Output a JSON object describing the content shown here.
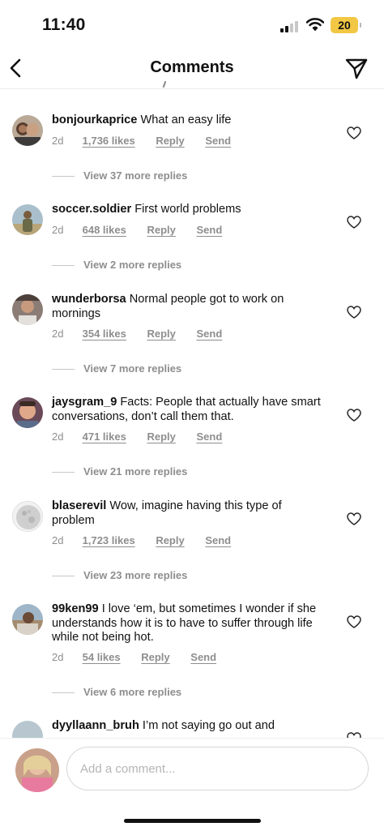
{
  "status": {
    "time": "11:40",
    "battery": "20"
  },
  "header": {
    "title": "Comments"
  },
  "comments": [
    {
      "username": "bonjourkaprice",
      "text": "What an easy life",
      "time": "2d",
      "likes": "1,736 likes",
      "reply": "Reply",
      "send": "Send",
      "replies": "View 37 more replies"
    },
    {
      "username": "soccer.soldier",
      "text": "First world problems",
      "time": "2d",
      "likes": "648 likes",
      "reply": "Reply",
      "send": "Send",
      "replies": "View 2 more replies"
    },
    {
      "username": "wunderborsa",
      "text": "Normal people got to work on mornings",
      "time": "2d",
      "likes": "354 likes",
      "reply": "Reply",
      "send": "Send",
      "replies": "View 7 more replies"
    },
    {
      "username": "jaysgram_9",
      "text": "Facts: People that actually have smart conversations, don’t call them that.",
      "time": "2d",
      "likes": "471 likes",
      "reply": "Reply",
      "send": "Send",
      "replies": "View 21 more replies"
    },
    {
      "username": "blaserevil",
      "text": "Wow, imagine having this type of problem",
      "time": "2d",
      "likes": "1,723 likes",
      "reply": "Reply",
      "send": "Send",
      "replies": "View 23 more replies"
    },
    {
      "username": "99ken99",
      "text": "I love ‘em, but sometimes I wonder if she understands how it is to have to suffer through life while not being hot.",
      "time": "2d",
      "likes": "54 likes",
      "reply": "Reply",
      "send": "Send",
      "replies": "View 6 more replies"
    },
    {
      "username": "dyyllaann_bruh",
      "text": "I’m not saying go out and"
    }
  ],
  "composer": {
    "placeholder": "Add a comment..."
  }
}
